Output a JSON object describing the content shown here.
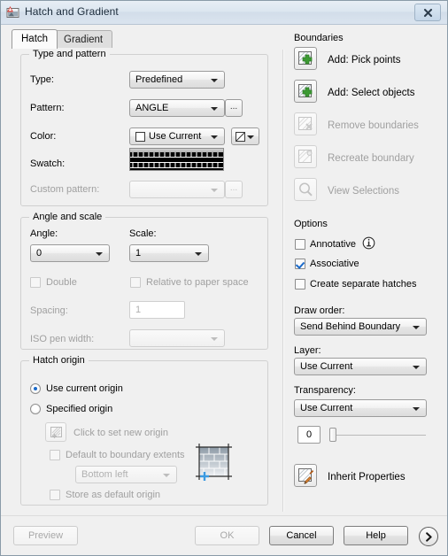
{
  "window": {
    "title": "Hatch and Gradient",
    "icon": "autocad-hatch-icon",
    "close_label": "Close"
  },
  "tabs": [
    {
      "id": "hatch",
      "label": "Hatch",
      "active": true
    },
    {
      "id": "gradient",
      "label": "Gradient",
      "active": false
    }
  ],
  "type_and_pattern": {
    "group_title": "Type and pattern",
    "type_label": "Type:",
    "type_value": "Predefined",
    "pattern_label": "Pattern:",
    "pattern_value": "ANGLE",
    "pattern_browse_label": "...",
    "color_label": "Color:",
    "color_value": "Use Current",
    "swatch_label": "Swatch:",
    "swatch_pattern": "ANGLE",
    "custom_pattern_label": "Custom pattern:",
    "custom_pattern_value": "",
    "custom_pattern_browse_label": "...",
    "custom_pattern_enabled": false
  },
  "angle_and_scale": {
    "group_title": "Angle and scale",
    "angle_label": "Angle:",
    "angle_value": "0",
    "scale_label": "Scale:",
    "scale_value": "1",
    "double_label": "Double",
    "double_checked": false,
    "double_enabled": false,
    "relative_label": "Relative to paper space",
    "relative_checked": false,
    "relative_enabled": false,
    "spacing_label": "Spacing:",
    "spacing_value": "1",
    "spacing_enabled": false,
    "iso_pen_label": "ISO pen width:",
    "iso_pen_value": "",
    "iso_pen_enabled": false
  },
  "hatch_origin": {
    "group_title": "Hatch origin",
    "use_current_label": "Use current origin",
    "use_current_selected": true,
    "specified_label": "Specified origin",
    "specified_selected": false,
    "set_new_origin_label": "Click to set new origin",
    "set_new_origin_enabled": false,
    "default_extents_label": "Default to boundary extents",
    "default_extents_checked": false,
    "default_extents_enabled": false,
    "extents_corner_value": "Bottom left",
    "extents_corner_enabled": false,
    "store_default_label": "Store as default origin",
    "store_default_checked": false,
    "store_default_enabled": false,
    "preview_icon": "brick-origin-preview"
  },
  "boundaries": {
    "group_title": "Boundaries",
    "items": [
      {
        "label": "Add: Pick points",
        "icon": "pick-points-icon",
        "enabled": true
      },
      {
        "label": "Add: Select objects",
        "icon": "select-objects-icon",
        "enabled": true
      },
      {
        "label": "Remove boundaries",
        "icon": "remove-boundaries-icon",
        "enabled": false
      },
      {
        "label": "Recreate boundary",
        "icon": "recreate-boundary-icon",
        "enabled": false
      },
      {
        "label": "View Selections",
        "icon": "view-selections-icon",
        "enabled": false
      }
    ]
  },
  "options": {
    "group_title": "Options",
    "annotative_label": "Annotative",
    "annotative_checked": false,
    "annotative_info_icon": "info-icon",
    "associative_label": "Associative",
    "associative_checked": true,
    "separate_hatches_label": "Create separate hatches",
    "separate_hatches_checked": false,
    "draw_order_label": "Draw order:",
    "draw_order_value": "Send Behind Boundary",
    "layer_label": "Layer:",
    "layer_value": "Use Current",
    "transparency_label": "Transparency:",
    "transparency_value": "Use Current",
    "transparency_amount": "0",
    "transparency_slider_percent": 0
  },
  "inherit": {
    "label": "Inherit Properties",
    "icon": "inherit-properties-icon",
    "enabled": true
  },
  "footer": {
    "preview_label": "Preview",
    "preview_enabled": false,
    "ok_label": "OK",
    "ok_enabled": false,
    "cancel_label": "Cancel",
    "help_label": "Help",
    "expand_label": "More Options",
    "expand_icon": "chevron-right-circle-icon"
  },
  "colors": {
    "dialog_bg": "#f0f0f0",
    "titlebar": "#dce6f0",
    "accent_check": "#1b6ac9",
    "green_plus": "#3c9a33",
    "swatch_bg": "#000000"
  }
}
